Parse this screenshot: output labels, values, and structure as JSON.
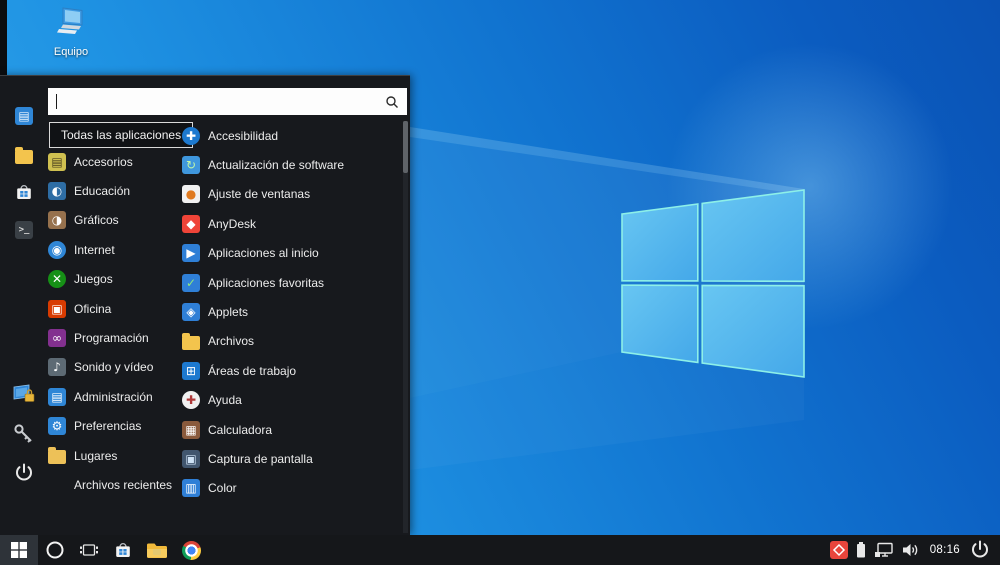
{
  "theme": {
    "menu_bg": "#17191d",
    "taskbar_bg": "#15171a",
    "accent_blue": "#2f86d6",
    "selection_border": "#d9d9d9",
    "wallpaper_light": "#34a7ec",
    "wallpaper_dark": "#0a52b4",
    "logo_fill": "#54b9ec",
    "logo_edge": "#8df0e8",
    "folder_yellow": "#f3c44d"
  },
  "desktop": {
    "computer_icon": {
      "label": "Equipo",
      "icon": "computer-icon"
    }
  },
  "start_menu": {
    "search": {
      "value": "",
      "placeholder": "",
      "icon": "search-icon"
    },
    "all_apps_button": {
      "label": "Todas las aplicaciones"
    },
    "sidebar": [
      {
        "icon": "software-manager-icon",
        "glyph": "▤",
        "bg": "#2f86d6",
        "fg": "#eaf4fd",
        "group": "top"
      },
      {
        "icon": "file-manager-icon",
        "shape": "folder",
        "bg": "#f3c44d",
        "group": "top"
      },
      {
        "icon": "store-icon",
        "svg": "store",
        "group": "top"
      },
      {
        "icon": "terminal-icon",
        "glyph": ">_",
        "bg": "#3a4046",
        "fg": "#d8d8d8",
        "small": true,
        "group": "top"
      },
      {
        "icon": "lock-screen-icon",
        "svg": "lockscreen",
        "group": "bottom"
      },
      {
        "icon": "session-key-icon",
        "svg": "key",
        "group": "bottom"
      },
      {
        "icon": "power-icon",
        "svg": "power",
        "group": "bottom"
      }
    ],
    "categories": [
      {
        "label": "Accesorios",
        "icon": "accessories-icon",
        "glyph": "▤",
        "bg": "#cfc050",
        "fg": "#4c431f"
      },
      {
        "label": "Educación",
        "icon": "education-icon",
        "glyph": "◐",
        "bg": "#2e6da4",
        "fg": "#ffffff"
      },
      {
        "label": "Gráficos",
        "icon": "graphics-icon",
        "glyph": "◑",
        "bg": "#96714d",
        "fg": "#ffffff"
      },
      {
        "label": "Internet",
        "icon": "internet-icon",
        "glyph": "◉",
        "bg": "#2f86d6",
        "fg": "#ffffff",
        "shape": "circle"
      },
      {
        "label": "Juegos",
        "icon": "games-icon",
        "glyph": "✕",
        "bg": "#169016",
        "fg": "#ffffff",
        "shape": "circle"
      },
      {
        "label": "Oficina",
        "icon": "office-icon",
        "glyph": "▣",
        "bg": "#d83b01",
        "fg": "#ffffff"
      },
      {
        "label": "Programación",
        "icon": "programming-icon",
        "glyph": "∞",
        "bg": "#83308f",
        "fg": "#ffffff"
      },
      {
        "label": "Sonido y vídeo",
        "icon": "sound-video-icon",
        "glyph": "♪",
        "bg": "#5d6a74",
        "fg": "#ffffff"
      },
      {
        "label": "Administración",
        "icon": "administration-icon",
        "glyph": "▤",
        "bg": "#2f86d6",
        "fg": "#ffffff"
      },
      {
        "label": "Preferencias",
        "icon": "preferences-icon",
        "glyph": "⚙",
        "bg": "#2f86d6",
        "fg": "#ffffff"
      },
      {
        "label": "Lugares",
        "icon": "places-icon",
        "shape": "folder",
        "bg": "#edc158"
      }
    ],
    "recent": {
      "label": "Archivos recientes"
    },
    "apps": [
      {
        "label": "Accesibilidad",
        "icon": "accessibility-icon",
        "glyph": "✚",
        "bg": "#1d79cf",
        "fg": "#ffffff",
        "shape": "circle"
      },
      {
        "label": "Actualización de software",
        "icon": "software-update-icon",
        "glyph": "↻",
        "bg": "#3f97dd",
        "fg": "#bff5a8"
      },
      {
        "label": "Ajuste de ventanas",
        "icon": "window-tweaks-icon",
        "glyph": "●",
        "bg": "#f1f1f1",
        "fg": "#e07a1f"
      },
      {
        "label": "AnyDesk",
        "icon": "anydesk-icon",
        "glyph": "◆",
        "bg": "#ef4438",
        "fg": "#ffffff"
      },
      {
        "label": "Aplicaciones al inicio",
        "icon": "startup-apps-icon",
        "glyph": "▶",
        "bg": "#2f7fd6",
        "fg": "#ffffff"
      },
      {
        "label": "Aplicaciones favoritas",
        "icon": "favorite-apps-icon",
        "glyph": "✓",
        "bg": "#2f7fd6",
        "fg": "#8fe77d"
      },
      {
        "label": "Applets",
        "icon": "applets-icon",
        "glyph": "◈",
        "bg": "#2f7fd6",
        "fg": "#ffffff"
      },
      {
        "label": "Archivos",
        "icon": "files-icon",
        "shape": "folder",
        "bg": "#f3c44d"
      },
      {
        "label": "Áreas de trabajo",
        "icon": "workspaces-icon",
        "glyph": "⊞",
        "bg": "#1d79cf",
        "fg": "#ffffff"
      },
      {
        "label": "Ayuda",
        "icon": "help-icon",
        "glyph": "✚",
        "bg": "#f1f1f1",
        "fg": "#b03a3a",
        "shape": "circle"
      },
      {
        "label": "Calculadora",
        "icon": "calculator-icon",
        "glyph": "▦",
        "bg": "#8a5a3c",
        "fg": "#ffffff"
      },
      {
        "label": "Captura de pantalla",
        "icon": "screenshot-icon",
        "glyph": "▣",
        "bg": "#41566e",
        "fg": "#cfe3f5"
      },
      {
        "label": "Color",
        "icon": "color-icon",
        "glyph": "▥",
        "bg": "#2f7fd6",
        "fg": "#ffffff"
      }
    ]
  },
  "taskbar": {
    "start": {
      "icon": "start-button-windows-icon"
    },
    "items": [
      {
        "icon": "cortana-search-icon",
        "svg": "cortana"
      },
      {
        "icon": "task-view-icon",
        "svg": "taskview"
      },
      {
        "icon": "store-icon",
        "svg": "store"
      },
      {
        "icon": "file-explorer-icon",
        "svg": "folder"
      },
      {
        "icon": "chrome-icon",
        "svg": "chrome"
      }
    ],
    "tray": {
      "items": [
        {
          "icon": "anydesk-tray-icon",
          "svg": "anydesk"
        },
        {
          "icon": "battery-icon",
          "svg": "battery"
        },
        {
          "icon": "network-icon",
          "svg": "network"
        },
        {
          "icon": "volume-icon",
          "svg": "volume"
        }
      ],
      "clock": "08:16",
      "power": {
        "icon": "power-icon",
        "svg": "power"
      }
    }
  }
}
